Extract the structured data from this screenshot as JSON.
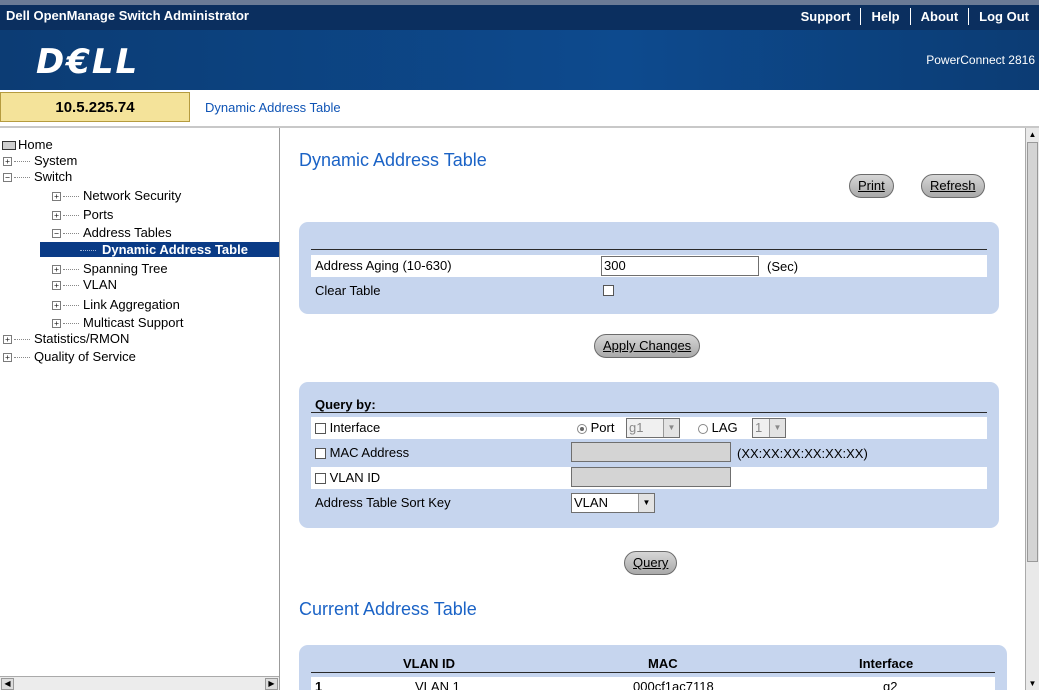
{
  "header": {
    "app_title": "Dell OpenManage Switch Administrator",
    "links": [
      "Support",
      "Help",
      "About",
      "Log Out"
    ],
    "logo": "D€LL",
    "product": "PowerConnect 2816"
  },
  "address_bar": {
    "ip": "10.5.225.74",
    "breadcrumb": "Dynamic Address Table"
  },
  "tree": {
    "home": "Home",
    "system": "System",
    "switch": "Switch",
    "network_security": "Network Security",
    "ports": "Ports",
    "address_tables": "Address Tables",
    "dynamic_address_table": "Dynamic Address Table",
    "spanning_tree": "Spanning Tree",
    "vlan": "VLAN",
    "link_aggregation": "Link Aggregation",
    "multicast_support": "Multicast Support",
    "statistics_rmon": "Statistics/RMON",
    "quality_of_service": "Quality of Service"
  },
  "main": {
    "title": "Dynamic Address Table",
    "print_label": "Print",
    "refresh_label": "Refresh",
    "aging_label": "Address Aging (10-630)",
    "aging_value": "300",
    "aging_unit": "(Sec)",
    "clear_table_label": "Clear Table",
    "apply_label": "Apply Changes"
  },
  "query": {
    "header": "Query by:",
    "interface_label": "Interface",
    "port_label": "Port",
    "port_value": "g1",
    "lag_label": "LAG",
    "lag_value": "1",
    "mac_label": "MAC Address",
    "mac_format": "(XX:XX:XX:XX:XX:XX)",
    "vlan_label": "VLAN ID",
    "sort_key_label": "Address Table Sort Key",
    "sort_key_value": "VLAN",
    "query_button": "Query"
  },
  "table": {
    "title": "Current Address Table",
    "headers": [
      "VLAN ID",
      "MAC",
      "Interface"
    ],
    "rows": [
      {
        "index": "1",
        "vlan": "VLAN 1",
        "mac": "000cf1ac7118",
        "interface": "g2"
      }
    ]
  }
}
